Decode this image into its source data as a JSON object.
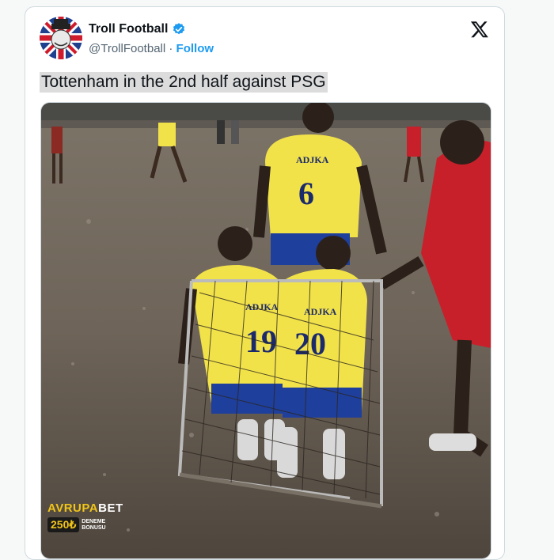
{
  "tweet": {
    "author": "Troll Football",
    "handle": "@TrollFootball",
    "separator": " · ",
    "follow_label": "Follow",
    "text": "Tottenham in the 2nd half against PSG"
  },
  "icons": {
    "verified": "verified-badge-icon",
    "x": "x-logo-icon"
  },
  "media": {
    "shirt_name": "ADJKA",
    "numbers": [
      "6",
      "19",
      "20"
    ],
    "watermark": {
      "brand_a": "AVRUPA",
      "brand_b": "BET",
      "amount": "250₺",
      "line1": "DENEME",
      "line2": "BONUSU"
    }
  },
  "colors": {
    "accent": "#1d9bf0",
    "text": "#0f1419",
    "muted": "#536471",
    "jersey_yellow": "#f2e24a",
    "jersey_blue": "#1f3f9c",
    "opponent_red": "#c8202a"
  }
}
